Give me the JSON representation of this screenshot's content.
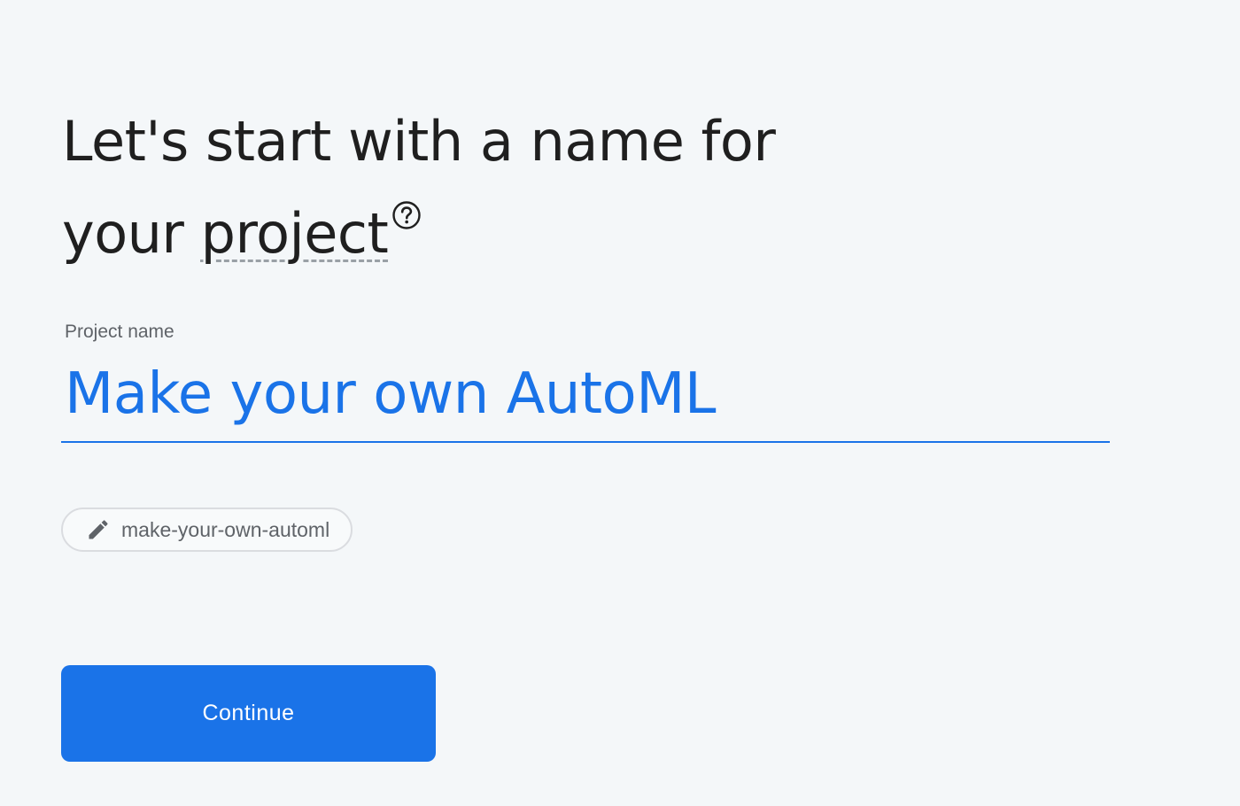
{
  "heading": {
    "line1": "Let's start with a name for",
    "line2_prefix": "your ",
    "line2_term": "project",
    "help_icon": "help-circle-icon"
  },
  "project_name_field": {
    "label": "Project name",
    "value": "Make your own AutoML"
  },
  "project_id_chip": {
    "icon": "pencil-icon",
    "value": "make-your-own-automl"
  },
  "continue_button": {
    "label": "Continue"
  },
  "colors": {
    "background": "#f4f7f9",
    "accent": "#1a73e8",
    "heading_text": "#1f1f1f",
    "muted_text": "#5f6368"
  }
}
